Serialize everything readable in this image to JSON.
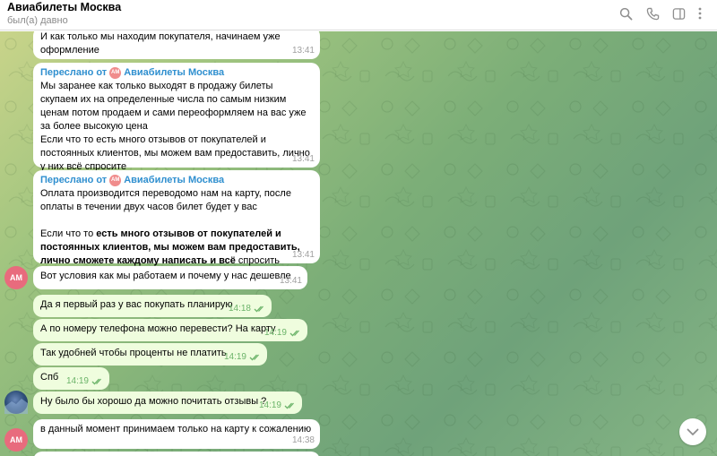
{
  "header": {
    "title": "Авиабилеты Москва",
    "status": "был(а) давно",
    "icons": [
      "search-icon",
      "phone-icon",
      "sidebar-icon",
      "more-icon"
    ]
  },
  "messages": [
    {
      "text": "И как только мы находим покупателя, начинаем уже оформление",
      "time": "13:41"
    },
    {
      "forward_label": "Переслано от",
      "forward_from": "Авиабилеты Москва",
      "forward_avatar": "AM",
      "text": "Мы заранее как только выходят в продажу билеты скупаем их на определенные числа по самым низким ценам потом продаем и сами переоформляем на вас уже за более высокую цена\nЕсли что то есть много отзывов от покупателей и постоянных клиентов, мы можем вам предоставить, лично у них всё спросите",
      "time": "13:41"
    },
    {
      "forward_label": "Переслано от",
      "forward_from": "Авиабилеты Москва",
      "forward_avatar": "AM",
      "text_part1": "Оплата производится переводомо нам на карту, после оплаты в течении двух часов билет будет у вас",
      "text_part2_prefix": "Если что то ",
      "text_part2_bold": "есть много отзывов от покупателей и постоянных клиентов, мы можем вам предоставить, лично сможете каждому написать и всё",
      "text_part2_suffix": " спросить",
      "time": "13:41"
    },
    {
      "text": "Вот условия как мы работаем и почему у нас дешевле",
      "time": "13:41",
      "avatar": "AM"
    },
    {
      "text": "Да я первый раз у вас покупать планирую",
      "time": "14:18",
      "outgoing": true
    },
    {
      "text": "А по номеру телефона можно перевести? На карту",
      "time": "14:19",
      "outgoing": true
    },
    {
      "text": "Так удобней чтобы проценты не платить",
      "time": "14:19",
      "outgoing": true
    },
    {
      "text": "Спб",
      "time": "14:19",
      "outgoing": true
    },
    {
      "text": "Ну было бы хорошо да можно почитать отзывы ?",
      "time": "14:19",
      "outgoing": true
    },
    {
      "text": "в данный момент принимаем только на карту к сожалению",
      "time": "14:38",
      "avatar": "AM"
    }
  ],
  "colors": {
    "accent": "#2f8fcf",
    "outgoing_bubble": "#effdde",
    "check": "#6cb46a",
    "avatar": "#e86b7d"
  }
}
